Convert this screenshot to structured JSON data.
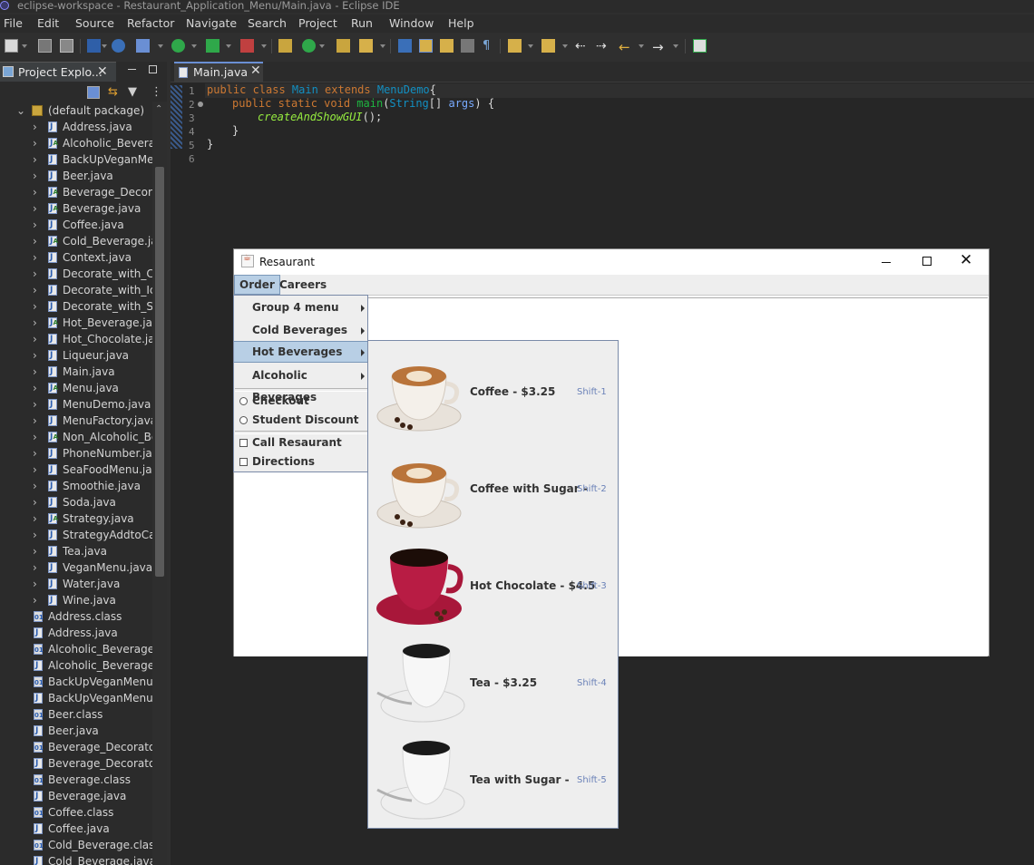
{
  "window": {
    "title": "eclipse-workspace - Restaurant_Application_Menu/Main.java - Eclipse IDE"
  },
  "menu": [
    "File",
    "Edit",
    "Source",
    "Refactor",
    "Navigate",
    "Search",
    "Project",
    "Run",
    "Window",
    "Help"
  ],
  "project_explorer": {
    "tab_label": "Project Explo...",
    "package": "(default package)",
    "files": [
      {
        "name": "Address.java",
        "icon": "java"
      },
      {
        "name": "Alcoholic_Beverag",
        "icon": "java-abstract"
      },
      {
        "name": "BackUpVeganMenu",
        "icon": "java"
      },
      {
        "name": "Beer.java",
        "icon": "java"
      },
      {
        "name": "Beverage_Decorato",
        "icon": "java-abstract"
      },
      {
        "name": "Beverage.java",
        "icon": "java-abstract"
      },
      {
        "name": "Coffee.java",
        "icon": "java"
      },
      {
        "name": "Cold_Beverage.java",
        "icon": "java-abstract"
      },
      {
        "name": "Context.java",
        "icon": "java"
      },
      {
        "name": "Decorate_with_Cre",
        "icon": "java"
      },
      {
        "name": "Decorate_with_Ice.",
        "icon": "java"
      },
      {
        "name": "Decorate_with_Sug",
        "icon": "java"
      },
      {
        "name": "Hot_Beverage.java",
        "icon": "java-abstract"
      },
      {
        "name": "Hot_Chocolate.jav",
        "icon": "java"
      },
      {
        "name": "Liqueur.java",
        "icon": "java"
      },
      {
        "name": "Main.java",
        "icon": "java"
      },
      {
        "name": "Menu.java",
        "icon": "java-abstract"
      },
      {
        "name": "MenuDemo.java",
        "icon": "java"
      },
      {
        "name": "MenuFactory.java",
        "icon": "java"
      },
      {
        "name": "Non_Alcoholic_Bev",
        "icon": "java-abstract"
      },
      {
        "name": "PhoneNumber.java",
        "icon": "java"
      },
      {
        "name": "SeaFoodMenu.java",
        "icon": "java"
      },
      {
        "name": "Smoothie.java",
        "icon": "java"
      },
      {
        "name": "Soda.java",
        "icon": "java"
      },
      {
        "name": "Strategy.java",
        "icon": "java-interface"
      },
      {
        "name": "StrategyAddtoCart",
        "icon": "java"
      },
      {
        "name": "Tea.java",
        "icon": "java"
      },
      {
        "name": "VeganMenu.java",
        "icon": "java"
      },
      {
        "name": "Water.java",
        "icon": "java"
      },
      {
        "name": "Wine.java",
        "icon": "java"
      }
    ],
    "output_files": [
      {
        "name": "Address.class",
        "icon": "class"
      },
      {
        "name": "Address.java",
        "icon": "java"
      },
      {
        "name": "Alcoholic_Beverage.cl",
        "icon": "class"
      },
      {
        "name": "Alcoholic_Beverage.ja",
        "icon": "java"
      },
      {
        "name": "BackUpVeganMenu.cl",
        "icon": "class"
      },
      {
        "name": "BackUpVeganMenu.ja",
        "icon": "java"
      },
      {
        "name": "Beer.class",
        "icon": "class"
      },
      {
        "name": "Beer.java",
        "icon": "java"
      },
      {
        "name": "Beverage_Decorator.c",
        "icon": "class"
      },
      {
        "name": "Beverage_Decorator.ja",
        "icon": "java"
      },
      {
        "name": "Beverage.class",
        "icon": "class"
      },
      {
        "name": "Beverage.java",
        "icon": "java"
      },
      {
        "name": "Coffee.class",
        "icon": "class"
      },
      {
        "name": "Coffee.java",
        "icon": "java"
      },
      {
        "name": "Cold_Beverage.class",
        "icon": "class"
      },
      {
        "name": "Cold_Beverage.java",
        "icon": "java"
      }
    ]
  },
  "editor": {
    "tab_label": "Main.java",
    "line_numbers": [
      "1",
      "2",
      "3",
      "4",
      "5",
      "6"
    ],
    "code": {
      "l1_kw": "public class ",
      "l1_cls": "Main",
      "l1_ext": " extends ",
      "l1_sup": "MenuDemo",
      "l1_end": "{",
      "l2_kw": "public static void ",
      "l2_m": "main",
      "l2_p1": "(",
      "l2_ty": "String",
      "l2_p2": "[] ",
      "l2_arg": "args",
      "l2_p3": ") {",
      "l3_call": "createAndShowGUI",
      "l3_end": "();",
      "l4": "}",
      "l5": "}"
    }
  },
  "app_window": {
    "title": "Resaurant",
    "menus": [
      "Order",
      "Careers"
    ],
    "order_menu": {
      "submenus": [
        "Group 4 menu",
        "Cold Beverages",
        "Hot Beverages",
        "Alcoholic Beverages"
      ],
      "radio_items": [
        "Checkout",
        "Student Discount"
      ],
      "check_items": [
        "Call Resaurant",
        "Directions"
      ]
    },
    "hot_beverages": [
      {
        "label": "Coffee - $3.25",
        "accel": "Shift-1",
        "image": "cappuccino-cup"
      },
      {
        "label": "Coffee with Sugar -",
        "accel": "Shift-2",
        "image": "cappuccino-cup"
      },
      {
        "label": "Hot Chocolate - $4.5",
        "accel": "Shift-3",
        "image": "red-cup"
      },
      {
        "label": "Tea - $3.25",
        "accel": "Shift-4",
        "image": "espresso-cup"
      },
      {
        "label": "Tea with Sugar -",
        "accel": "Shift-5",
        "image": "espresso-cup"
      }
    ]
  },
  "colors": {
    "ide_bg": "#2f2f2f",
    "menu_highlight": "#b8cfe5",
    "keyword": "#cc7832",
    "type": "#1290c3"
  }
}
